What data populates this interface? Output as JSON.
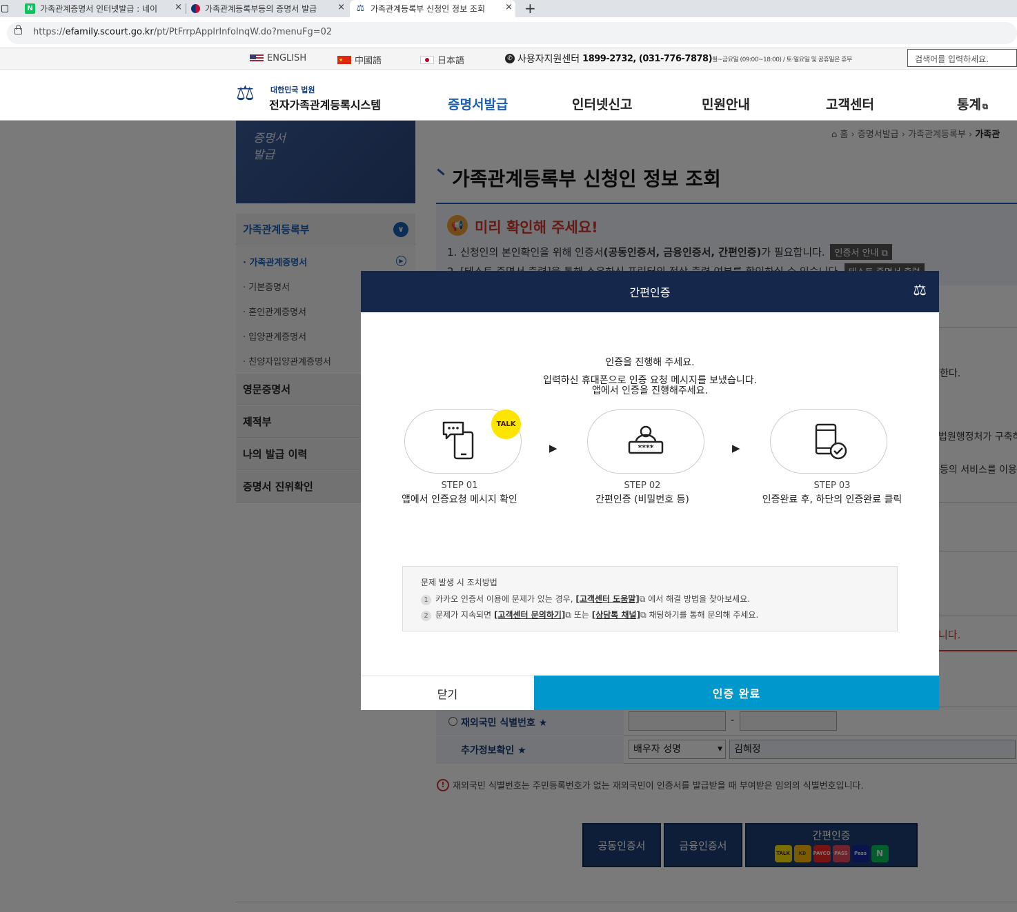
{
  "browser": {
    "tabs": [
      {
        "title": "가족관계증명서 인터넷발급 : 네이",
        "favicon": "naver-icon",
        "close": "×"
      },
      {
        "title": "가족관계등록부등의 증명서 발급",
        "favicon": "korea-flag-icon",
        "close": "×"
      },
      {
        "title": "가족관계등록부 신청인 정보 조회",
        "favicon": "court-icon",
        "close": "×"
      }
    ],
    "new_tab": "+",
    "url_prefix": "https://",
    "url_domain": "efamily.scourt.go.kr",
    "url_path": "/pt/PtFrrpApplrInfoInqW.do?menuFg=02"
  },
  "util": {
    "langs": [
      "ENGLISH",
      "中國語",
      "日本語"
    ],
    "support_label": "사용자지원센터",
    "support_phone": "1899-2732, (031-776-7878)",
    "support_hours": "월~금요일 (09:00~18:00) / 토·일요일 및 공휴일은 휴무",
    "search_placeholder": "검색어를 입력하세요."
  },
  "header": {
    "logo_top": "대한민국 법원",
    "logo_main": "전자가족관계등록시스템",
    "gnb": [
      "증명서발급",
      "인터넷신고",
      "민원안내",
      "고객센터",
      "통계"
    ]
  },
  "sidebar": {
    "visual_text": "증명서 발급",
    "group_title": "가족관계등록부",
    "sub_items": [
      "가족관계증명서",
      "기본증명서",
      "혼인관계증명서",
      "입양관계증명서",
      "친양자입양관계증명서"
    ],
    "items": [
      "영문증명서",
      "제적부",
      "나의 발급 이력",
      "증명서 진위확인"
    ]
  },
  "content": {
    "breadcrumb": [
      "홈",
      "증명서발급",
      "가족관계등록부",
      "가족관"
    ],
    "title": "가족관계등록부 신청인 정보 조회",
    "notice_title": "미리 확인해 주세요!",
    "notice_1a": "1. 신청인의 본인확인을 위해 인증서",
    "notice_1b": "(공동인증서, 금융인증서, 간편인증)",
    "notice_1c": "가 필요합니다.",
    "notice_1_btn": "인증서 안내",
    "notice_2": "2. [테스트 증명서 출력]을 통해 소유하신 프린터의 정상 출력 여부를 확인하실 수 있습니다.",
    "notice_2_btn": "테스트 증명서 출력",
    "side_frag_1": "한다.",
    "side_frag_2": "법원행정처가 구축하",
    "side_frag_3": "등의 서비스를 이용하",
    "side_frag_4": "니다.",
    "row_foreign_label": "재외국민 식별번호",
    "row_extra_label": "추가정보확인",
    "dash": "-",
    "select_value": "배우자 성명",
    "name_value": "김혜정",
    "warning": "재외국민 식별번호는 주민등록번호가 없는 재외국민이 인증서를 발급받을 때 부여받은 임의의 식별번호입니다.",
    "cert_buttons": [
      "공동인증서",
      "금융인증서",
      "간편인증"
    ],
    "mini_icons": [
      "TALK",
      "KB",
      "PAYCO",
      "PASS",
      "Pass",
      "N"
    ]
  },
  "modal": {
    "title": "간편인증",
    "intro_1": "인증을 진행해 주세요.",
    "intro_2": "입력하신 휴대폰으로 인증 요청 메시지를 보냈습니다.",
    "intro_3": "앱에서 인증을 진행해주세요.",
    "talk_badge": "TALK",
    "steps": [
      {
        "step": "STEP 01",
        "desc": "앱에서 인증요청 메시지 확인"
      },
      {
        "step": "STEP 02",
        "desc": "간편인증 (비밀번호 등)"
      },
      {
        "step": "STEP 03",
        "desc": "인증완료 후, 하단의 인증완료 클릭"
      }
    ],
    "help_title": "문제 발생 시 조치방법",
    "help_1a": "카카오 인증서 이용에 문제가 있는 경우,",
    "help_1_link": "[고객센터 도움말]",
    "help_1b": "에서 해결 방법을 찾아보세요.",
    "help_2a": "문제가 지속되면",
    "help_2_link1": "[고객센터 문의하기]",
    "help_2b": "또는",
    "help_2_link2": "[상담톡 채널]",
    "help_2c": "채팅하기를 통해 문의해 주세요.",
    "close_button": "닫기",
    "done_button": "인증 완료"
  },
  "colors": {
    "modal_header": "#15284b",
    "done_button": "#0097cc",
    "accent_blue": "#1a5fb4",
    "notice_red": "#d33a2c"
  }
}
